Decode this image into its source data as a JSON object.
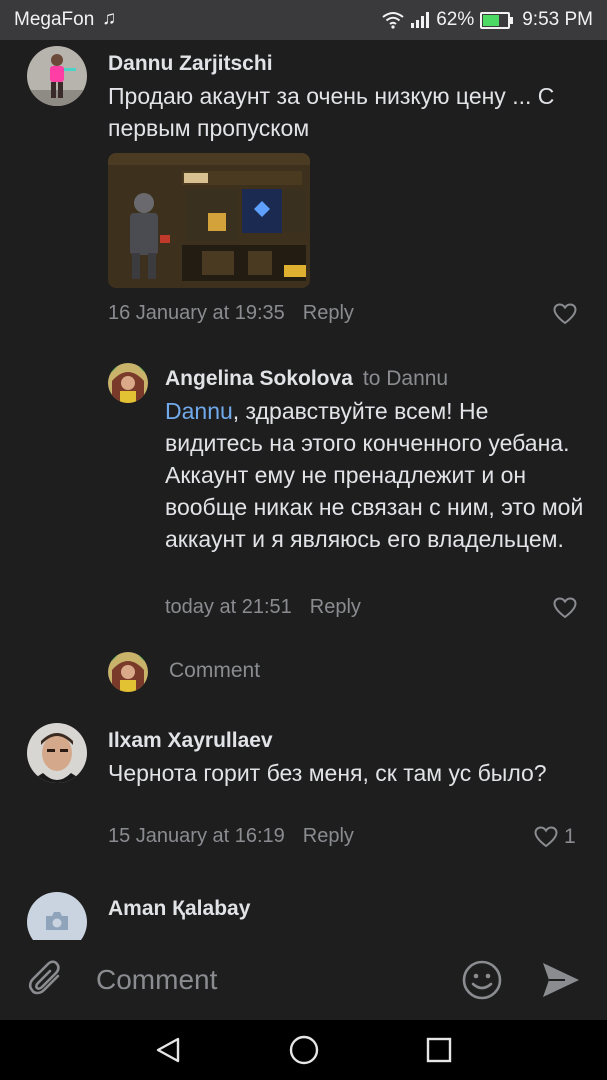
{
  "status_bar": {
    "carrier": "MegaFon",
    "battery": "62%",
    "time": "9:53 PM"
  },
  "comments": [
    {
      "author": "Dannu Zarjitschi",
      "text": "Продаю акаунт за очень низкую цену ... С первым пропуском",
      "timestamp": "16 January at 19:35",
      "reply_label": "Reply"
    },
    {
      "author": "Angelina Sokolova",
      "to": "to Dannu",
      "mention": "Dannu",
      "text": ", здравствуйте всем! Не видитесь на этого конченного уебана. Аккаунт ему не пренадлежит и он вообще никак не связан с ним, это мой аккаунт и я являюсь его владельцем.",
      "timestamp": "today at 21:51",
      "reply_label": "Reply"
    },
    {
      "author": "Ilxam Xayrullaev",
      "text": "Чернота горит без меня, ск там ус было?",
      "timestamp": "15 January at 16:19",
      "reply_label": "Reply",
      "likes": "1"
    },
    {
      "author": "Aman Қalabay"
    }
  ],
  "inline_comment_placeholder": "Comment",
  "input_bar": {
    "placeholder": "Comment",
    "icons": [
      "paperclip-icon",
      "emoji-icon",
      "send-icon"
    ]
  },
  "nav_bar": {
    "icons": [
      "back-icon",
      "home-icon",
      "recents-icon"
    ]
  },
  "colors": {
    "background": "#1e1e1f",
    "text": "#e1e3e6",
    "secondary_text": "#8a8c90",
    "link": "#71aaeb",
    "status_bar": "#3a3a3c"
  }
}
